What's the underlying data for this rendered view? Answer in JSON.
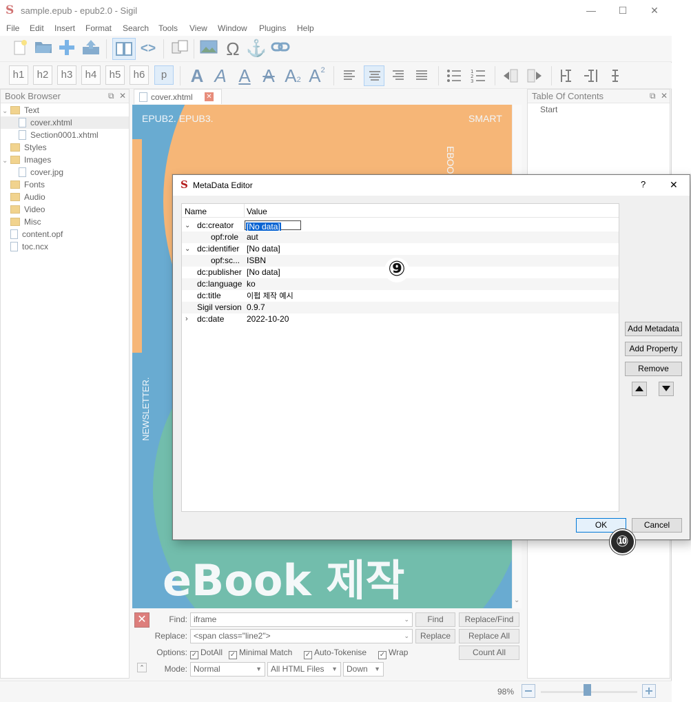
{
  "window": {
    "title": "sample.epub - epub2.0 - Sigil",
    "logo_letter": "S",
    "controls": {
      "minimize": "—",
      "maximize": "☐",
      "close": "✕"
    }
  },
  "menu": [
    "File",
    "Edit",
    "Insert",
    "Format",
    "Search",
    "Tools",
    "View",
    "Window",
    "Plugins",
    "Help"
  ],
  "toolbar": {
    "headings": [
      "h1",
      "h2",
      "h3",
      "h4",
      "h5",
      "h6",
      "p"
    ],
    "code_view": "<>",
    "omega": "Ω",
    "anchor": "⚓"
  },
  "book_browser": {
    "title": "Book Browser",
    "items": [
      {
        "label": "Text",
        "type": "folder",
        "expanded": true,
        "level": 0
      },
      {
        "label": "cover.xhtml",
        "type": "file",
        "level": 1,
        "selected": true
      },
      {
        "label": "Section0001.xhtml",
        "type": "file",
        "level": 1
      },
      {
        "label": "Styles",
        "type": "folder",
        "level": 0
      },
      {
        "label": "Images",
        "type": "folder",
        "expanded": true,
        "level": 0
      },
      {
        "label": "cover.jpg",
        "type": "file",
        "level": 1
      },
      {
        "label": "Fonts",
        "type": "folder",
        "level": 0
      },
      {
        "label": "Audio",
        "type": "folder",
        "level": 0
      },
      {
        "label": "Video",
        "type": "folder",
        "level": 0
      },
      {
        "label": "Misc",
        "type": "folder",
        "level": 0
      },
      {
        "label": "content.opf",
        "type": "file",
        "level": 0
      },
      {
        "label": "toc.ncx",
        "type": "file",
        "level": 0
      }
    ]
  },
  "editor": {
    "tab_label": "cover.xhtml",
    "cover": {
      "top_left": "EPUB2. EPUB3.",
      "top_right": "SMART",
      "vertical_right": "EBOOK.",
      "vertical_left": "NEWSLETTER.",
      "big_text": "eBook 제작"
    }
  },
  "toc": {
    "title": "Table Of Contents",
    "items": [
      "Start"
    ]
  },
  "find_replace": {
    "find_label": "Find:",
    "find_value": "iframe",
    "replace_label": "Replace:",
    "replace_value": "<span class=\"line2\">",
    "options_label": "Options:",
    "options": [
      {
        "label": "DotAll",
        "checked": true
      },
      {
        "label": "Minimal Match",
        "checked": true
      },
      {
        "label": "Auto-Tokenise",
        "checked": true
      },
      {
        "label": "Wrap",
        "checked": true
      }
    ],
    "mode_label": "Mode:",
    "mode_value": "Normal",
    "scope_value": "All HTML Files",
    "direction_value": "Down",
    "buttons": {
      "find": "Find",
      "replace_find": "Replace/Find",
      "replace": "Replace",
      "replace_all": "Replace All",
      "count_all": "Count All"
    }
  },
  "status": {
    "zoom": "98%"
  },
  "dialog": {
    "title": "MetaData Editor",
    "help": "?",
    "close": "✕",
    "columns": {
      "name": "Name",
      "value": "Value"
    },
    "rows": [
      {
        "name": "dc:creator",
        "value": "[No data]",
        "level": 0,
        "expander": "expanded",
        "editing": true
      },
      {
        "name": "opf:role",
        "value": "aut",
        "level": 1
      },
      {
        "name": "dc:identifier",
        "value": "[No data]",
        "level": 0,
        "expander": "expanded"
      },
      {
        "name": "opf:sc...",
        "value": "ISBN",
        "level": 1
      },
      {
        "name": "dc:publisher",
        "value": "[No data]",
        "level": 0
      },
      {
        "name": "dc:language",
        "value": "ko",
        "level": 0
      },
      {
        "name": "dc:title",
        "value": "이펍 제작 예시",
        "level": 0
      },
      {
        "name": "Sigil version",
        "value": "0.9.7",
        "level": 0
      },
      {
        "name": "dc:date",
        "value": "2022-10-20",
        "level": 0,
        "expander": "collapsed"
      }
    ],
    "buttons": {
      "add_metadata": "Add Metadata",
      "add_property": "Add Property",
      "remove": "Remove",
      "ok": "OK",
      "cancel": "Cancel"
    },
    "callouts": {
      "table": "⑨",
      "ok": "⑩"
    }
  },
  "colors": {
    "cover_blue": "#0e78b5",
    "cover_orange": "#f08a24",
    "cover_green": "#1f9a6e",
    "selection_blue": "#0a64d2"
  }
}
